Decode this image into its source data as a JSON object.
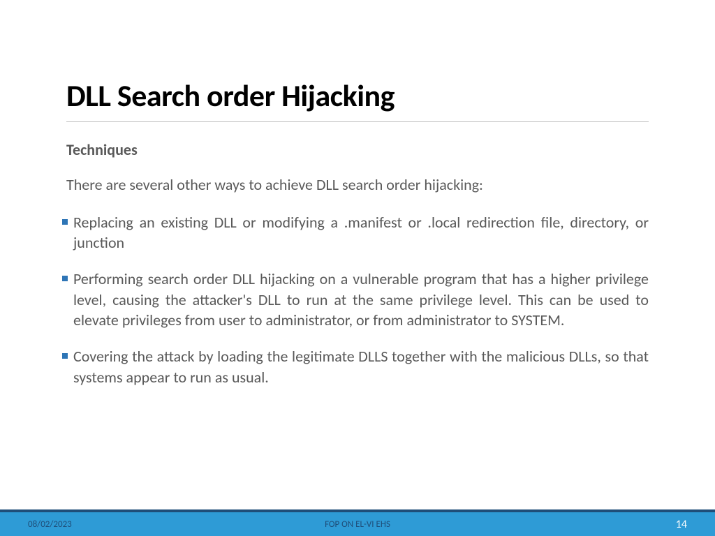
{
  "slide": {
    "title": "DLL Search order Hijacking",
    "subtitle": "Techniques",
    "intro": "There are several other ways to achieve DLL search order hijacking:",
    "bullets": [
      "Replacing an existing DLL or modifying a .manifest or .local redirection file, directory, or junction",
      "Performing search order DLL hijacking on a vulnerable program that has a higher privilege level, causing the attacker's DLL to run at the same privilege level. This can be used to elevate privileges from user to administrator, or from administrator to SYSTEM.",
      "Covering the attack by loading the legitimate DLLS together with the malicious DLLs, so that systems appear to run as usual."
    ]
  },
  "footer": {
    "date": "08/02/2023",
    "center": "FOP ON EL-VI EHS",
    "page": "14"
  }
}
